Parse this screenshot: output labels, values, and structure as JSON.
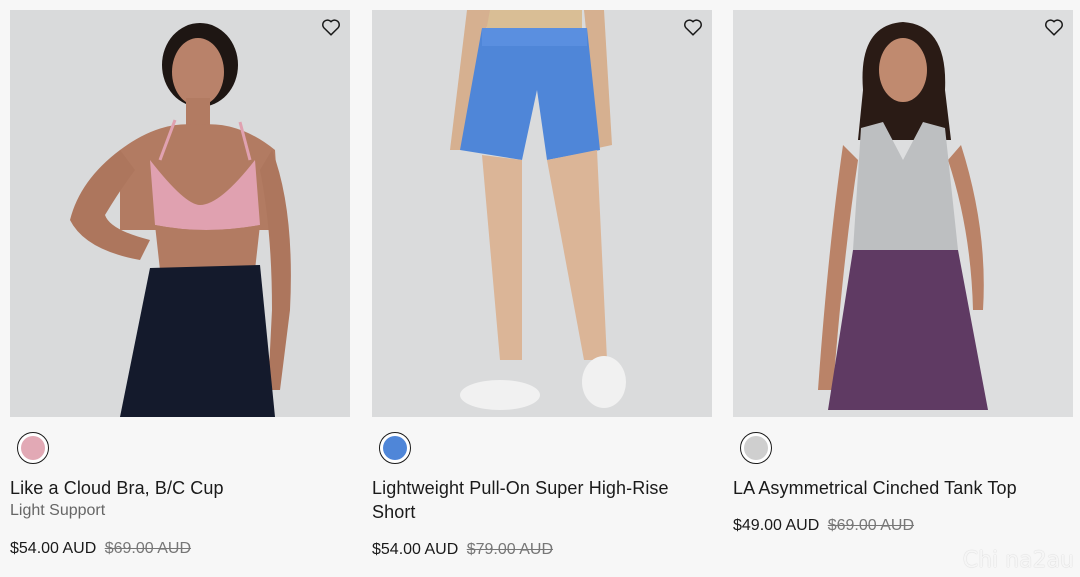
{
  "products": [
    {
      "name": "Like a Cloud Bra, B/C Cup",
      "subtitle": "Light Support",
      "price": "$54.00 AUD",
      "old_price": "$69.00 AUD",
      "swatch_color": "#e2a9b5"
    },
    {
      "name": "Lightweight Pull-On Super High-Rise Short",
      "subtitle": "",
      "price": "$54.00 AUD",
      "old_price": "$79.00 AUD",
      "swatch_color": "#4f86d8"
    },
    {
      "name": "LA Asymmetrical Cinched Tank Top",
      "subtitle": "",
      "price": "$49.00 AUD",
      "old_price": "$69.00 AUD",
      "swatch_color": "#cfcfcf"
    }
  ],
  "icons": {
    "wishlist": "heart-outline-icon"
  },
  "watermark": "Chi na2au"
}
